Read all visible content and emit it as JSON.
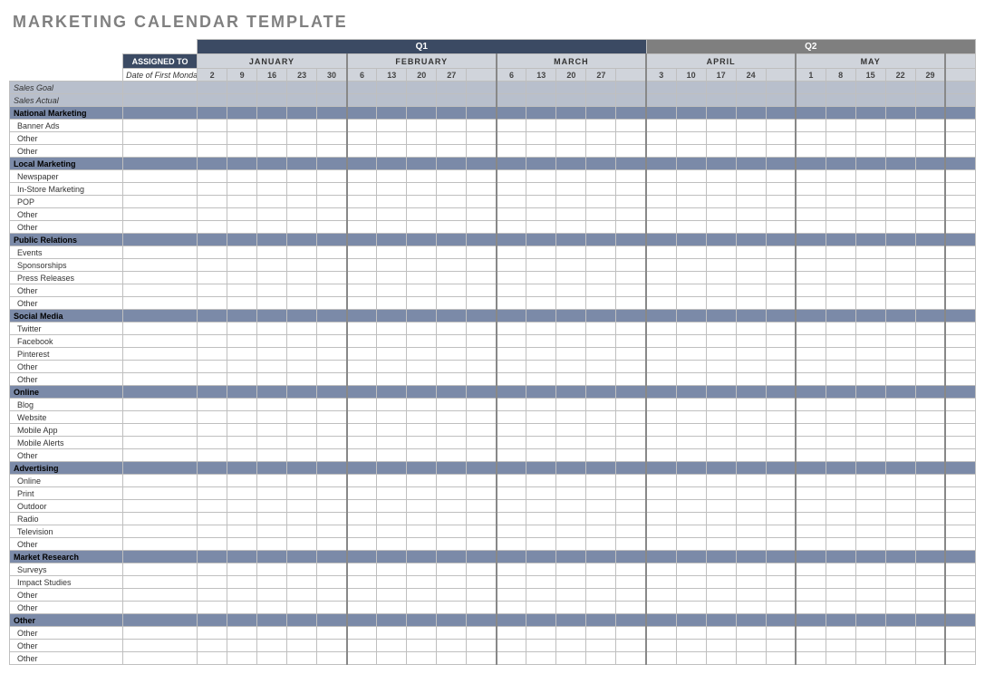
{
  "title": "MARKETING CALENDAR TEMPLATE",
  "headers": {
    "assigned_to": "ASSIGNED TO",
    "date_label": "Date of First Monday"
  },
  "quarters": [
    {
      "name": "Q1",
      "months": [
        {
          "name": "JANUARY",
          "days": [
            "2",
            "9",
            "16",
            "23",
            "30"
          ]
        },
        {
          "name": "FEBRUARY",
          "days": [
            "6",
            "13",
            "20",
            "27",
            ""
          ]
        },
        {
          "name": "MARCH",
          "days": [
            "6",
            "13",
            "20",
            "27",
            ""
          ]
        }
      ]
    },
    {
      "name": "Q2",
      "months": [
        {
          "name": "APRIL",
          "days": [
            "3",
            "10",
            "17",
            "24",
            ""
          ]
        },
        {
          "name": "MAY",
          "days": [
            "1",
            "8",
            "15",
            "22",
            "29"
          ]
        },
        {
          "name": "",
          "days": [
            "",
            "",
            "",
            "",
            ""
          ],
          "partial": true
        }
      ]
    }
  ],
  "sales_rows": [
    "Sales Goal",
    "Sales Actual"
  ],
  "categories": [
    {
      "name": "National Marketing",
      "items": [
        "Banner Ads",
        "Other",
        "Other"
      ]
    },
    {
      "name": "Local Marketing",
      "items": [
        "Newspaper",
        "In-Store Marketing",
        "POP",
        "Other",
        "Other"
      ]
    },
    {
      "name": "Public Relations",
      "items": [
        "Events",
        "Sponsorships",
        "Press Releases",
        "Other",
        "Other"
      ]
    },
    {
      "name": "Social Media",
      "items": [
        "Twitter",
        "Facebook",
        "Pinterest",
        "Other",
        "Other"
      ]
    },
    {
      "name": "Online",
      "items": [
        "Blog",
        "Website",
        "Mobile App",
        "Mobile Alerts",
        "Other"
      ]
    },
    {
      "name": "Advertising",
      "items": [
        "Online",
        "Print",
        "Outdoor",
        "Radio",
        "Television",
        "Other"
      ]
    },
    {
      "name": "Market Research",
      "items": [
        "Surveys",
        "Impact Studies",
        "Other",
        "Other"
      ]
    },
    {
      "name": "Other",
      "items": [
        "Other",
        "Other",
        "Other"
      ]
    }
  ]
}
